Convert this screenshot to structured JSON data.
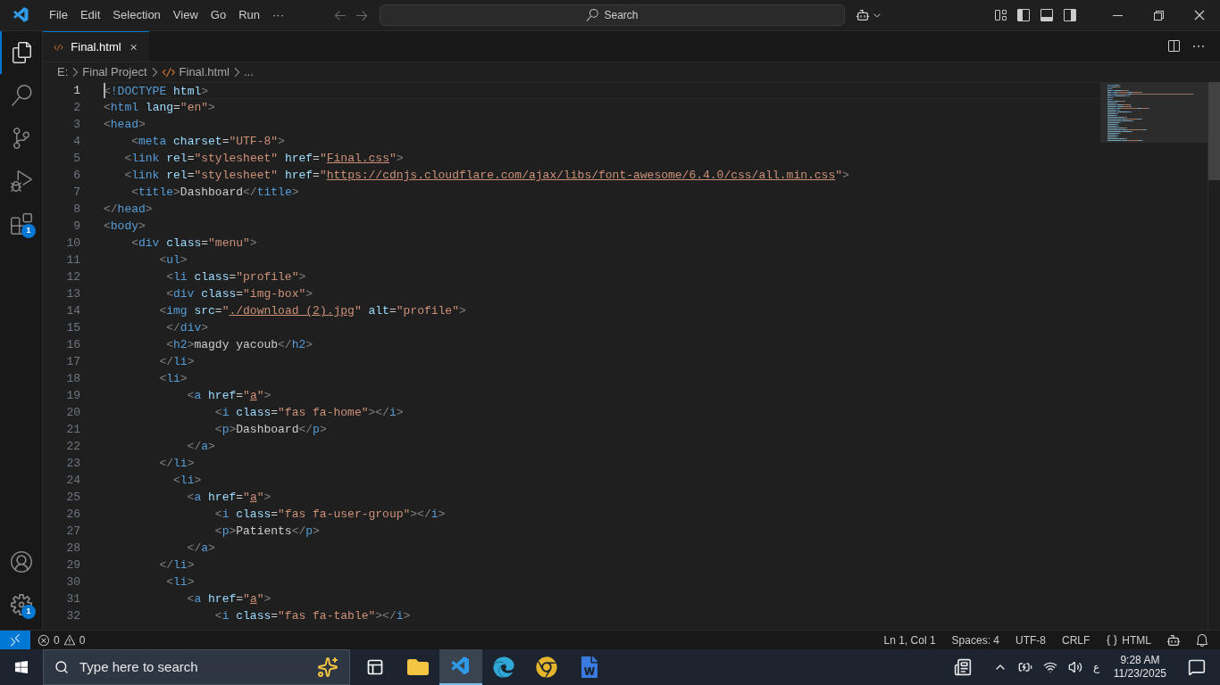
{
  "menu": [
    "File",
    "Edit",
    "Selection",
    "View",
    "Go",
    "Run",
    "···"
  ],
  "command_center": {
    "label": "Search"
  },
  "activity_bar": {
    "top": [
      {
        "kind": "files",
        "selected": true
      },
      {
        "kind": "search",
        "selected": false
      },
      {
        "kind": "source-control",
        "selected": false
      },
      {
        "kind": "run-debug",
        "selected": false
      },
      {
        "kind": "extensions",
        "selected": false,
        "badge": "1"
      }
    ],
    "bottom": [
      {
        "kind": "account",
        "selected": false
      },
      {
        "kind": "settings",
        "selected": false,
        "badge": "1"
      }
    ]
  },
  "tabs": [
    {
      "label": "Final.html",
      "selected": true
    }
  ],
  "breadcrumb": [
    {
      "label": "E:",
      "kind": "folder"
    },
    {
      "label": "Final Project",
      "kind": "folder"
    },
    {
      "label": "Final.html",
      "kind": "file"
    },
    {
      "label": "...",
      "kind": "more"
    }
  ],
  "editor": {
    "lines": [
      {
        "number": "1",
        "selected": true,
        "tokens": [
          {
            "kind": "punct",
            "text": "<"
          },
          {
            "kind": "tag",
            "text": "!DOCTYPE"
          },
          {
            "kind": "attr",
            "text": " html"
          },
          {
            "kind": "punct",
            "text": ">"
          }
        ]
      },
      {
        "number": "2",
        "selected": false,
        "tokens": [
          {
            "kind": "punct",
            "text": "<"
          },
          {
            "kind": "tag",
            "text": "html"
          },
          {
            "kind": "attr",
            "text": " lang"
          },
          {
            "kind": "text",
            "text": "="
          },
          {
            "kind": "str",
            "text": "\"en\""
          },
          {
            "kind": "punct",
            "text": ">"
          }
        ]
      },
      {
        "number": "3",
        "selected": false,
        "tokens": [
          {
            "kind": "punct",
            "text": "<"
          },
          {
            "kind": "tag",
            "text": "head"
          },
          {
            "kind": "punct",
            "text": ">"
          }
        ]
      },
      {
        "number": "4",
        "selected": false,
        "tokens": [
          {
            "kind": "punct",
            "text": "    <"
          },
          {
            "kind": "tag",
            "text": "meta"
          },
          {
            "kind": "attr",
            "text": " charset"
          },
          {
            "kind": "text",
            "text": "="
          },
          {
            "kind": "str",
            "text": "\"UTF-8\""
          },
          {
            "kind": "punct",
            "text": ">"
          }
        ]
      },
      {
        "number": "5",
        "selected": false,
        "tokens": [
          {
            "kind": "punct",
            "text": "   <"
          },
          {
            "kind": "tag",
            "text": "link"
          },
          {
            "kind": "attr",
            "text": " rel"
          },
          {
            "kind": "text",
            "text": "="
          },
          {
            "kind": "str",
            "text": "\"stylesheet\""
          },
          {
            "kind": "attr",
            "text": " href"
          },
          {
            "kind": "text",
            "text": "="
          },
          {
            "kind": "str",
            "text": "\""
          },
          {
            "kind": "link",
            "text": "Final.css"
          },
          {
            "kind": "str",
            "text": "\""
          },
          {
            "kind": "punct",
            "text": ">"
          }
        ]
      },
      {
        "number": "6",
        "selected": false,
        "tokens": [
          {
            "kind": "punct",
            "text": "   <"
          },
          {
            "kind": "tag",
            "text": "link"
          },
          {
            "kind": "attr",
            "text": " rel"
          },
          {
            "kind": "text",
            "text": "="
          },
          {
            "kind": "str",
            "text": "\"stylesheet\""
          },
          {
            "kind": "attr",
            "text": " href"
          },
          {
            "kind": "text",
            "text": "="
          },
          {
            "kind": "str",
            "text": "\""
          },
          {
            "kind": "link",
            "text": "https://cdnjs.cloudflare.com/ajax/libs/font-awesome/6.4.0/css/all.min.css"
          },
          {
            "kind": "str",
            "text": "\""
          },
          {
            "kind": "punct",
            "text": ">"
          }
        ]
      },
      {
        "number": "7",
        "selected": false,
        "tokens": [
          {
            "kind": "punct",
            "text": "    <"
          },
          {
            "kind": "tag",
            "text": "title"
          },
          {
            "kind": "punct",
            "text": ">"
          },
          {
            "kind": "text",
            "text": "Dashboard"
          },
          {
            "kind": "punct",
            "text": "</"
          },
          {
            "kind": "tag",
            "text": "title"
          },
          {
            "kind": "punct",
            "text": ">"
          }
        ]
      },
      {
        "number": "8",
        "selected": false,
        "tokens": [
          {
            "kind": "punct",
            "text": "</"
          },
          {
            "kind": "tag",
            "text": "head"
          },
          {
            "kind": "punct",
            "text": ">"
          }
        ]
      },
      {
        "number": "9",
        "selected": false,
        "tokens": [
          {
            "kind": "punct",
            "text": "<"
          },
          {
            "kind": "tag",
            "text": "body"
          },
          {
            "kind": "punct",
            "text": ">"
          }
        ]
      },
      {
        "number": "10",
        "selected": false,
        "tokens": [
          {
            "kind": "punct",
            "text": "    <"
          },
          {
            "kind": "tag",
            "text": "div"
          },
          {
            "kind": "attr",
            "text": " class"
          },
          {
            "kind": "text",
            "text": "="
          },
          {
            "kind": "str",
            "text": "\"menu\""
          },
          {
            "kind": "punct",
            "text": ">"
          }
        ]
      },
      {
        "number": "11",
        "selected": false,
        "tokens": [
          {
            "kind": "punct",
            "text": "        <"
          },
          {
            "kind": "tag",
            "text": "ul"
          },
          {
            "kind": "punct",
            "text": ">"
          }
        ]
      },
      {
        "number": "12",
        "selected": false,
        "tokens": [
          {
            "kind": "punct",
            "text": "         <"
          },
          {
            "kind": "tag",
            "text": "li"
          },
          {
            "kind": "attr",
            "text": " class"
          },
          {
            "kind": "text",
            "text": "="
          },
          {
            "kind": "str",
            "text": "\"profile\""
          },
          {
            "kind": "punct",
            "text": ">"
          }
        ]
      },
      {
        "number": "13",
        "selected": false,
        "tokens": [
          {
            "kind": "punct",
            "text": "         <"
          },
          {
            "kind": "tag",
            "text": "div"
          },
          {
            "kind": "attr",
            "text": " class"
          },
          {
            "kind": "text",
            "text": "="
          },
          {
            "kind": "str",
            "text": "\"img-box\""
          },
          {
            "kind": "punct",
            "text": ">"
          }
        ]
      },
      {
        "number": "14",
        "selected": false,
        "tokens": [
          {
            "kind": "punct",
            "text": "        <"
          },
          {
            "kind": "tag",
            "text": "img"
          },
          {
            "kind": "attr",
            "text": " src"
          },
          {
            "kind": "text",
            "text": "="
          },
          {
            "kind": "str",
            "text": "\""
          },
          {
            "kind": "link",
            "text": "./download (2).jpg"
          },
          {
            "kind": "str",
            "text": "\""
          },
          {
            "kind": "attr",
            "text": " alt"
          },
          {
            "kind": "text",
            "text": "="
          },
          {
            "kind": "str",
            "text": "\"profile\""
          },
          {
            "kind": "punct",
            "text": ">"
          }
        ]
      },
      {
        "number": "15",
        "selected": false,
        "tokens": [
          {
            "kind": "punct",
            "text": "         </"
          },
          {
            "kind": "tag",
            "text": "div"
          },
          {
            "kind": "punct",
            "text": ">"
          }
        ]
      },
      {
        "number": "16",
        "selected": false,
        "tokens": [
          {
            "kind": "punct",
            "text": "         <"
          },
          {
            "kind": "tag",
            "text": "h2"
          },
          {
            "kind": "punct",
            "text": ">"
          },
          {
            "kind": "text",
            "text": "magdy yacoub"
          },
          {
            "kind": "punct",
            "text": "</"
          },
          {
            "kind": "tag",
            "text": "h2"
          },
          {
            "kind": "punct",
            "text": ">"
          }
        ]
      },
      {
        "number": "17",
        "selected": false,
        "tokens": [
          {
            "kind": "punct",
            "text": "        </"
          },
          {
            "kind": "tag",
            "text": "li"
          },
          {
            "kind": "punct",
            "text": ">"
          }
        ]
      },
      {
        "number": "18",
        "selected": false,
        "tokens": [
          {
            "kind": "punct",
            "text": "        <"
          },
          {
            "kind": "tag",
            "text": "li"
          },
          {
            "kind": "punct",
            "text": ">"
          }
        ]
      },
      {
        "number": "19",
        "selected": false,
        "tokens": [
          {
            "kind": "punct",
            "text": "            <"
          },
          {
            "kind": "tag",
            "text": "a"
          },
          {
            "kind": "attr",
            "text": " href"
          },
          {
            "kind": "text",
            "text": "="
          },
          {
            "kind": "str",
            "text": "\""
          },
          {
            "kind": "link",
            "text": "a"
          },
          {
            "kind": "str",
            "text": "\""
          },
          {
            "kind": "punct",
            "text": ">"
          }
        ]
      },
      {
        "number": "20",
        "selected": false,
        "tokens": [
          {
            "kind": "punct",
            "text": "                <"
          },
          {
            "kind": "tag",
            "text": "i"
          },
          {
            "kind": "attr",
            "text": " class"
          },
          {
            "kind": "text",
            "text": "="
          },
          {
            "kind": "str",
            "text": "\"fas fa-home\""
          },
          {
            "kind": "punct",
            "text": "></"
          },
          {
            "kind": "tag",
            "text": "i"
          },
          {
            "kind": "punct",
            "text": ">"
          }
        ]
      },
      {
        "number": "21",
        "selected": false,
        "tokens": [
          {
            "kind": "punct",
            "text": "                <"
          },
          {
            "kind": "tag",
            "text": "p"
          },
          {
            "kind": "punct",
            "text": ">"
          },
          {
            "kind": "text",
            "text": "Dashboard"
          },
          {
            "kind": "punct",
            "text": "</"
          },
          {
            "kind": "tag",
            "text": "p"
          },
          {
            "kind": "punct",
            "text": ">"
          }
        ]
      },
      {
        "number": "22",
        "selected": false,
        "tokens": [
          {
            "kind": "punct",
            "text": "            </"
          },
          {
            "kind": "tag",
            "text": "a"
          },
          {
            "kind": "punct",
            "text": ">"
          }
        ]
      },
      {
        "number": "23",
        "selected": false,
        "tokens": [
          {
            "kind": "punct",
            "text": "        </"
          },
          {
            "kind": "tag",
            "text": "li"
          },
          {
            "kind": "punct",
            "text": ">"
          }
        ]
      },
      {
        "number": "24",
        "selected": false,
        "tokens": [
          {
            "kind": "punct",
            "text": "          <"
          },
          {
            "kind": "tag",
            "text": "li"
          },
          {
            "kind": "punct",
            "text": ">"
          }
        ]
      },
      {
        "number": "25",
        "selected": false,
        "tokens": [
          {
            "kind": "punct",
            "text": "            <"
          },
          {
            "kind": "tag",
            "text": "a"
          },
          {
            "kind": "attr",
            "text": " href"
          },
          {
            "kind": "text",
            "text": "="
          },
          {
            "kind": "str",
            "text": "\""
          },
          {
            "kind": "link",
            "text": "a"
          },
          {
            "kind": "str",
            "text": "\""
          },
          {
            "kind": "punct",
            "text": ">"
          }
        ]
      },
      {
        "number": "26",
        "selected": false,
        "tokens": [
          {
            "kind": "punct",
            "text": "                <"
          },
          {
            "kind": "tag",
            "text": "i"
          },
          {
            "kind": "attr",
            "text": " class"
          },
          {
            "kind": "text",
            "text": "="
          },
          {
            "kind": "str",
            "text": "\"fas fa-user-group\""
          },
          {
            "kind": "punct",
            "text": "></"
          },
          {
            "kind": "tag",
            "text": "i"
          },
          {
            "kind": "punct",
            "text": ">"
          }
        ]
      },
      {
        "number": "27",
        "selected": false,
        "tokens": [
          {
            "kind": "punct",
            "text": "                <"
          },
          {
            "kind": "tag",
            "text": "p"
          },
          {
            "kind": "punct",
            "text": ">"
          },
          {
            "kind": "text",
            "text": "Patients"
          },
          {
            "kind": "punct",
            "text": "</"
          },
          {
            "kind": "tag",
            "text": "p"
          },
          {
            "kind": "punct",
            "text": ">"
          }
        ]
      },
      {
        "number": "28",
        "selected": false,
        "tokens": [
          {
            "kind": "punct",
            "text": "            </"
          },
          {
            "kind": "tag",
            "text": "a"
          },
          {
            "kind": "punct",
            "text": ">"
          }
        ]
      },
      {
        "number": "29",
        "selected": false,
        "tokens": [
          {
            "kind": "punct",
            "text": "        </"
          },
          {
            "kind": "tag",
            "text": "li"
          },
          {
            "kind": "punct",
            "text": ">"
          }
        ]
      },
      {
        "number": "30",
        "selected": false,
        "tokens": [
          {
            "kind": "punct",
            "text": "         <"
          },
          {
            "kind": "tag",
            "text": "li"
          },
          {
            "kind": "punct",
            "text": ">"
          }
        ]
      },
      {
        "number": "31",
        "selected": false,
        "tokens": [
          {
            "kind": "punct",
            "text": "            <"
          },
          {
            "kind": "tag",
            "text": "a"
          },
          {
            "kind": "attr",
            "text": " href"
          },
          {
            "kind": "text",
            "text": "="
          },
          {
            "kind": "str",
            "text": "\""
          },
          {
            "kind": "link",
            "text": "a"
          },
          {
            "kind": "str",
            "text": "\""
          },
          {
            "kind": "punct",
            "text": ">"
          }
        ]
      },
      {
        "number": "32",
        "selected": false,
        "tokens": [
          {
            "kind": "punct",
            "text": "                <"
          },
          {
            "kind": "tag",
            "text": "i"
          },
          {
            "kind": "attr",
            "text": " class"
          },
          {
            "kind": "text",
            "text": "="
          },
          {
            "kind": "str",
            "text": "\"fas fa-table\""
          },
          {
            "kind": "punct",
            "text": "></"
          },
          {
            "kind": "tag",
            "text": "i"
          },
          {
            "kind": "punct",
            "text": ">"
          }
        ]
      }
    ]
  },
  "status_bar": {
    "errors": "0",
    "warnings": "0",
    "items": [
      "Ln 1, Col 1",
      "Spaces: 4",
      "UTF-8",
      "CRLF"
    ],
    "language": "HTML"
  },
  "taskbar": {
    "search_placeholder": "Type here to search",
    "apps": [
      {
        "kind": "task-view",
        "selected": false
      },
      {
        "kind": "explorer",
        "selected": false
      },
      {
        "kind": "vscode",
        "selected": true
      },
      {
        "kind": "edge",
        "selected": false
      },
      {
        "kind": "chrome",
        "selected": false
      },
      {
        "kind": "word",
        "selected": false
      }
    ],
    "input_language": "ع",
    "time": "9:28 AM",
    "date": "11/23/2025"
  }
}
